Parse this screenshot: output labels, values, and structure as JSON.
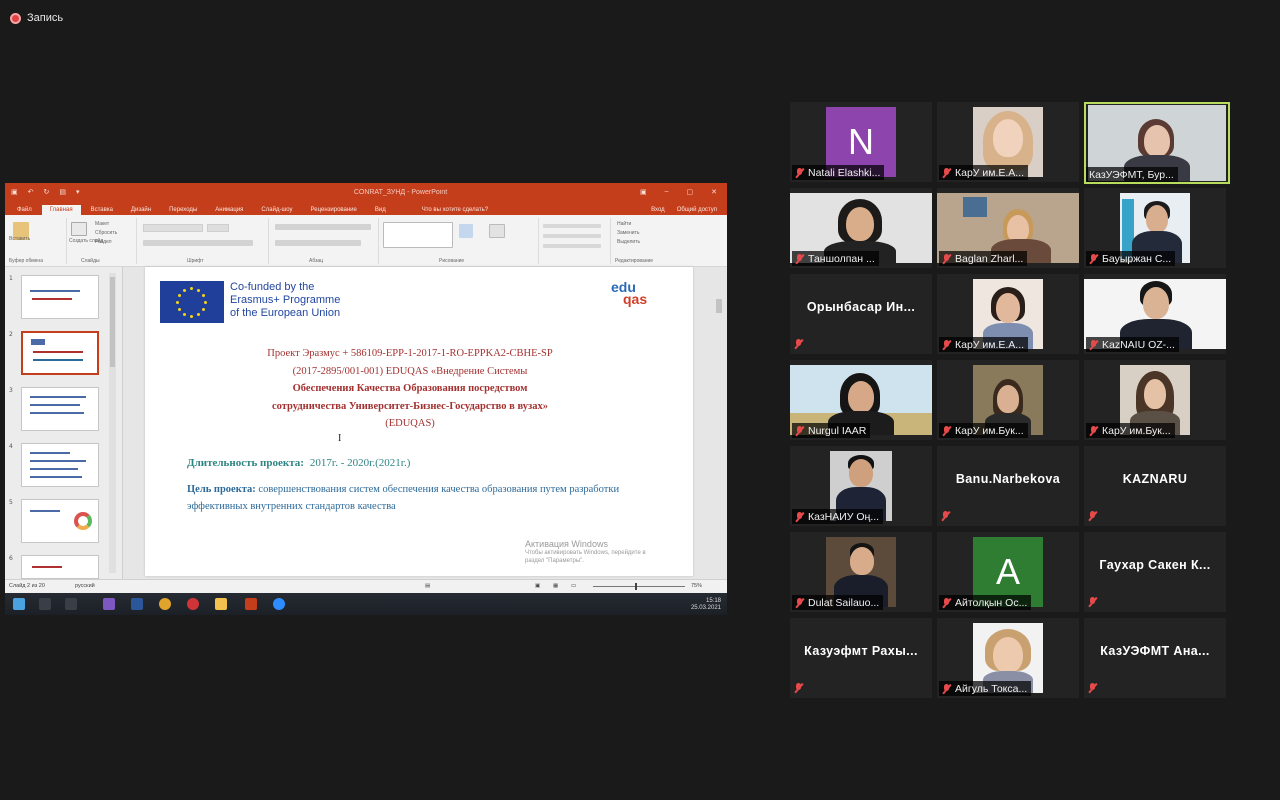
{
  "recording": {
    "label": "Запись"
  },
  "powerpoint": {
    "window_title": "CONRAT_ЗУНД - PowerPoint",
    "tabs": [
      "Файл",
      "Главная",
      "Вставка",
      "Дизайн",
      "Переходы",
      "Анимация",
      "Слайд-шоу",
      "Рецензирование",
      "Вид"
    ],
    "tell_me": "Что вы хотите сделать?",
    "right_tabs": [
      "Вход",
      "Общий доступ"
    ],
    "ribbon_groups": [
      "Буфер обмена",
      "Слайды",
      "Шрифт",
      "Абзац",
      "Рисование",
      "Редактирование"
    ],
    "ribbon_buttons": [
      "Вставить",
      "Создать слайд",
      "Макет",
      "Сбросить",
      "Раздел",
      "Найти",
      "Заменить",
      "Выделить"
    ],
    "slide_count": "Слайд 2 из 20",
    "status_lang": "русский",
    "zoom": "75%",
    "slide": {
      "cofunded": [
        "Co-funded by the",
        "Erasmus+ Programme",
        "of the European Union"
      ],
      "logo_top": "edu",
      "logo_bottom": "qas",
      "project_lines": [
        "Проект  Эразмус + 586109-EPP-1-2017-1-RO-EPPKA2-CBHE-SP",
        "(2017-2895/001-001) EDUQAS  «Внедрение Системы",
        "Обеспечения Качества Образования посредством",
        "сотрудничества Университет-Бизнес-Государство  в вузах»",
        "(EDUQAS)"
      ],
      "cursor": "I",
      "duration_label": "Длительность  проекта:",
      "duration_value": "2017г. - 2020г.(2021г.)",
      "goal_label": "Цель проекта:",
      "goal_text": "совершенствования систем обеспечения качества образования путем разработки эффективных внутренних стандартов качества",
      "watermark_title": "Активация Windows",
      "watermark_sub1": "Чтобы активировать Windows, перейдите в",
      "watermark_sub2": "раздел \"Параметры\"."
    },
    "taskbar_time": "15:18",
    "taskbar_date": "25.03.2021"
  },
  "participants": [
    {
      "name": "Natali Elashki...",
      "type": "avatar",
      "letter": "N",
      "color": "#8e44ad"
    },
    {
      "name": "КарУ им.Е.А...",
      "type": "video"
    },
    {
      "name": "КазУЭФМТ, Бур...",
      "type": "video",
      "active": true
    },
    {
      "name": "Таншолпан ...",
      "type": "video"
    },
    {
      "name": "Baglan Zharl...",
      "type": "video"
    },
    {
      "name": "Бауыржан С...",
      "type": "video"
    },
    {
      "name": "Орынбасар  Ин...",
      "type": "name"
    },
    {
      "name": "КарУ им.Е.А...",
      "type": "video"
    },
    {
      "name": "KazNAIU OZ-...",
      "type": "video"
    },
    {
      "name": "Nurgul IAAR",
      "type": "video"
    },
    {
      "name": "КарУ им.Бук...",
      "type": "video"
    },
    {
      "name": "КарУ им.Бук...",
      "type": "video"
    },
    {
      "name": "КазНАИУ Оң...",
      "type": "video"
    },
    {
      "name": "Banu.Narbekova",
      "type": "name"
    },
    {
      "name": "KAZNARU",
      "type": "name"
    },
    {
      "name": "Dulat Sailauo...",
      "type": "video"
    },
    {
      "name": "Айтолқын Ос...",
      "type": "avatar",
      "letter": "A",
      "color": "#2e7d32"
    },
    {
      "name": "Гаухар  Сакен  К...",
      "type": "name"
    },
    {
      "name": "Казуэфмт  Рахы...",
      "type": "name"
    },
    {
      "name": "Айгуль Токса...",
      "type": "video"
    },
    {
      "name": "КазУЭФМТ  Ана...",
      "type": "name"
    }
  ]
}
